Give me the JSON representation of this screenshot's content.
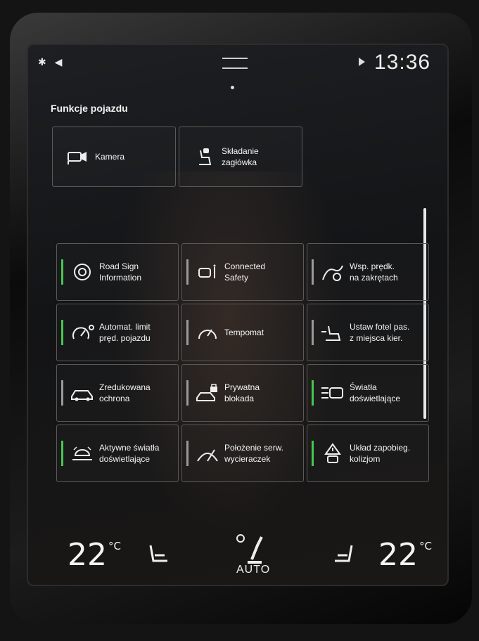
{
  "status": {
    "left_icons": "✱ ◀",
    "time": "13:36"
  },
  "section_title": "Funkcje pojazdu",
  "top_tiles": [
    {
      "line1": "Kamera",
      "line2": ""
    },
    {
      "line1": "Składanie",
      "line2": "zagłówka"
    }
  ],
  "tiles": [
    {
      "line1": "Road Sign",
      "line2": "Information",
      "active": true
    },
    {
      "line1": "Connected",
      "line2": "Safety",
      "active": false
    },
    {
      "line1": "Wsp. prędk.",
      "line2": "na zakrętach",
      "active": false
    },
    {
      "line1": "Automat. limit",
      "line2": "pręd. pojazdu",
      "active": true
    },
    {
      "line1": "Tempomat",
      "line2": "",
      "active": false
    },
    {
      "line1": "Ustaw fotel pas.",
      "line2": "z miejsca kier.",
      "active": false
    },
    {
      "line1": "Zredukowana",
      "line2": "ochrona",
      "active": false
    },
    {
      "line1": "Prywatna",
      "line2": "blokada",
      "active": false
    },
    {
      "line1": "Światła",
      "line2": "doświetlające",
      "active": true
    },
    {
      "line1": "Aktywne światła",
      "line2": "doświetlające",
      "active": true
    },
    {
      "line1": "Położenie serw.",
      "line2": "wycieraczek",
      "active": false
    },
    {
      "line1": "Układ zapobieg.",
      "line2": "kolizjom",
      "active": true
    }
  ],
  "climate": {
    "left_temp": "22",
    "right_temp": "22",
    "unit": "°C",
    "mode": "AUTO"
  },
  "colors": {
    "indicator_on": "#47c750",
    "indicator_off": "#9a9a9a"
  }
}
